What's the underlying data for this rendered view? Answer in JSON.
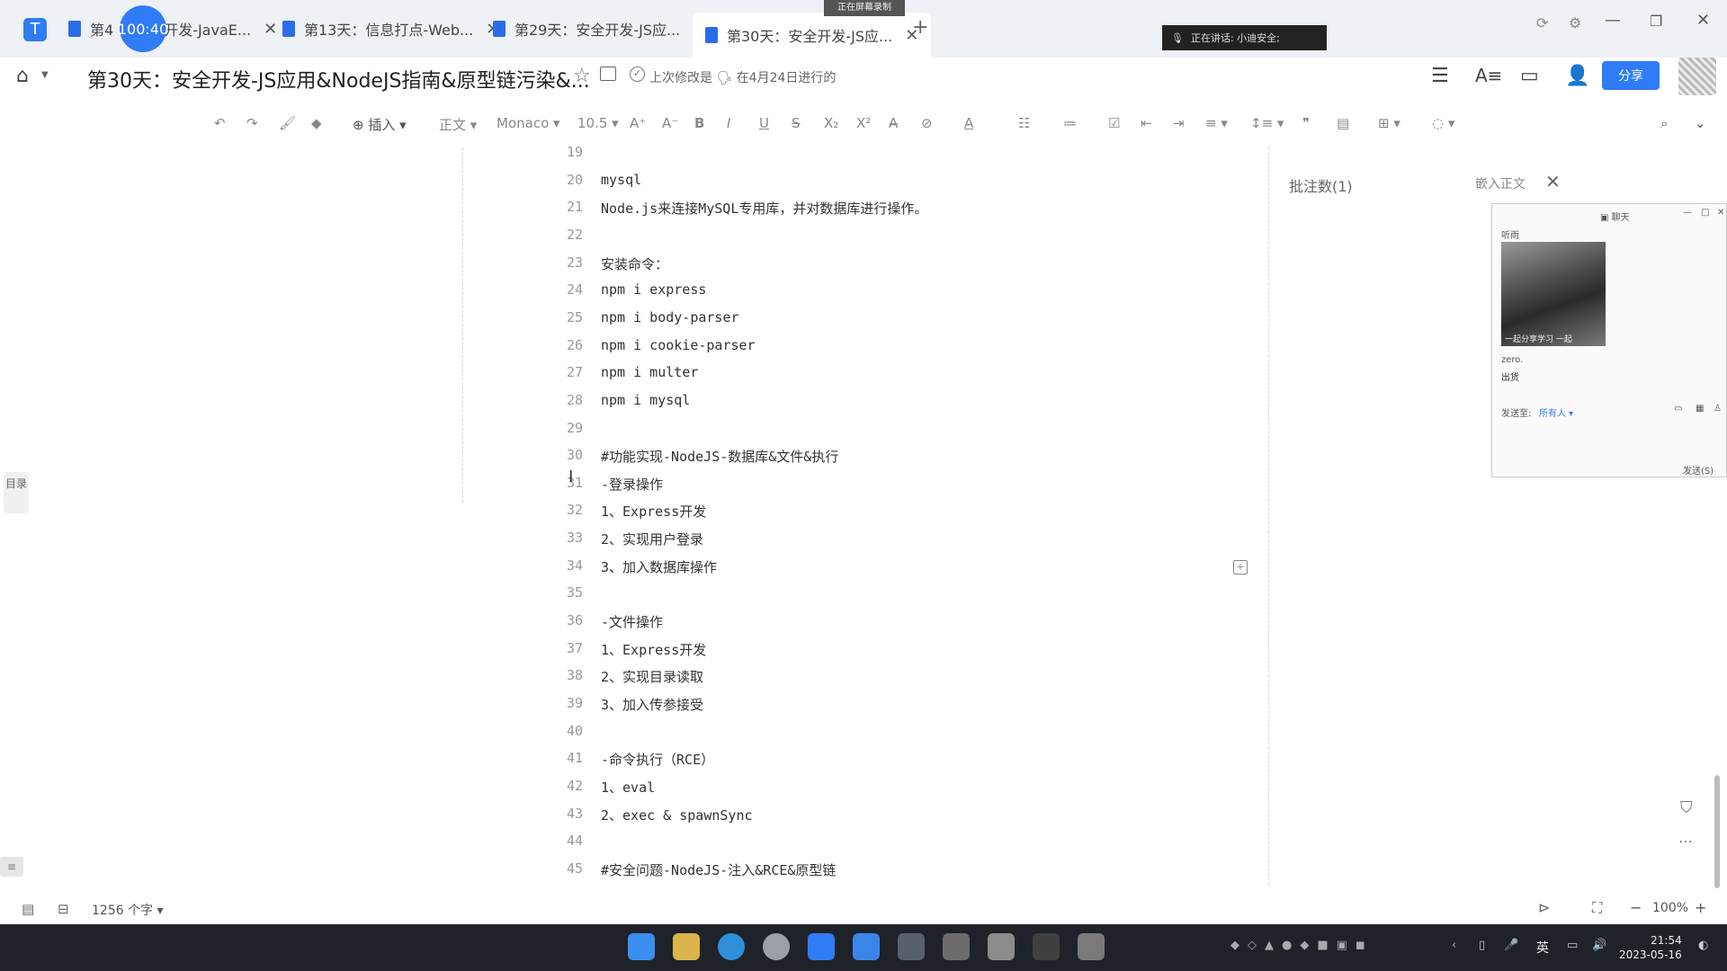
{
  "tabs": [
    {
      "label": "第4",
      "suffix": "开发-JavaE..."
    },
    {
      "label": "第13天：信息打点-Web..."
    },
    {
      "label": "第29天：安全开发-JS应..."
    },
    {
      "label": "第30天：安全开发-JS应..."
    }
  ],
  "recording_timer": "100:40",
  "recording_bar": "正在屏幕录制",
  "share_bar": "正在讲话: 小迪安全;",
  "header": {
    "title": "第30天：安全开发-JS应用&NodeJS指南&原型链污染&...",
    "last_edit": "上次修改是 🗣 在4月24日进行的",
    "share": "分享"
  },
  "toolbar": {
    "insert": "插入",
    "style": "正文",
    "font": "Monaco",
    "size": "10.5"
  },
  "lines": [
    {
      "n": "19",
      "t": ""
    },
    {
      "n": "20",
      "t": "mysql"
    },
    {
      "n": "21",
      "t": "Node.js来连接MySQL专用库，并对数据库进行操作。"
    },
    {
      "n": "22",
      "t": ""
    },
    {
      "n": "23",
      "t": "安装命令："
    },
    {
      "n": "24",
      "t": "npm i express"
    },
    {
      "n": "25",
      "t": "npm i body-parser"
    },
    {
      "n": "26",
      "t": "npm i cookie-parser"
    },
    {
      "n": "27",
      "t": "npm i multer"
    },
    {
      "n": "28",
      "t": "npm i mysql"
    },
    {
      "n": "29",
      "t": ""
    },
    {
      "n": "30",
      "t": "#功能实现-NodeJS-数据库&文件&执行"
    },
    {
      "n": "31",
      "t": "-登录操作"
    },
    {
      "n": "32",
      "t": "1、Express开发"
    },
    {
      "n": "33",
      "t": "2、实现用户登录"
    },
    {
      "n": "34",
      "t": "3、加入数据库操作"
    },
    {
      "n": "35",
      "t": ""
    },
    {
      "n": "36",
      "t": "-文件操作"
    },
    {
      "n": "37",
      "t": "1、Express开发"
    },
    {
      "n": "38",
      "t": "2、实现目录读取"
    },
    {
      "n": "39",
      "t": "3、加入传参接受"
    },
    {
      "n": "40",
      "t": ""
    },
    {
      "n": "41",
      "t": "-命令执行（RCE）"
    },
    {
      "n": "42",
      "t": "1、eval"
    },
    {
      "n": "43",
      "t": "2、exec & spawnSync"
    },
    {
      "n": "44",
      "t": ""
    },
    {
      "n": "45",
      "t": "#安全问题-NodeJS-注入&RCE&原型链"
    }
  ],
  "comments": {
    "title": "批注数(1)",
    "embed": "嵌入正文"
  },
  "chat": {
    "title": "聊天",
    "name1": "听雨",
    "caption": "一起分享学习 一起",
    "name2": "zero.",
    "msg": "出货",
    "send_to_label": "发送至:",
    "send_to_value": "所有人",
    "send": "发送(S)"
  },
  "toc_label": "目录",
  "status": {
    "word_count": "1256 个字",
    "zoom": "100%"
  },
  "clock": {
    "time": "21:54",
    "date": "2023-05-16"
  },
  "tray_lang": "英"
}
